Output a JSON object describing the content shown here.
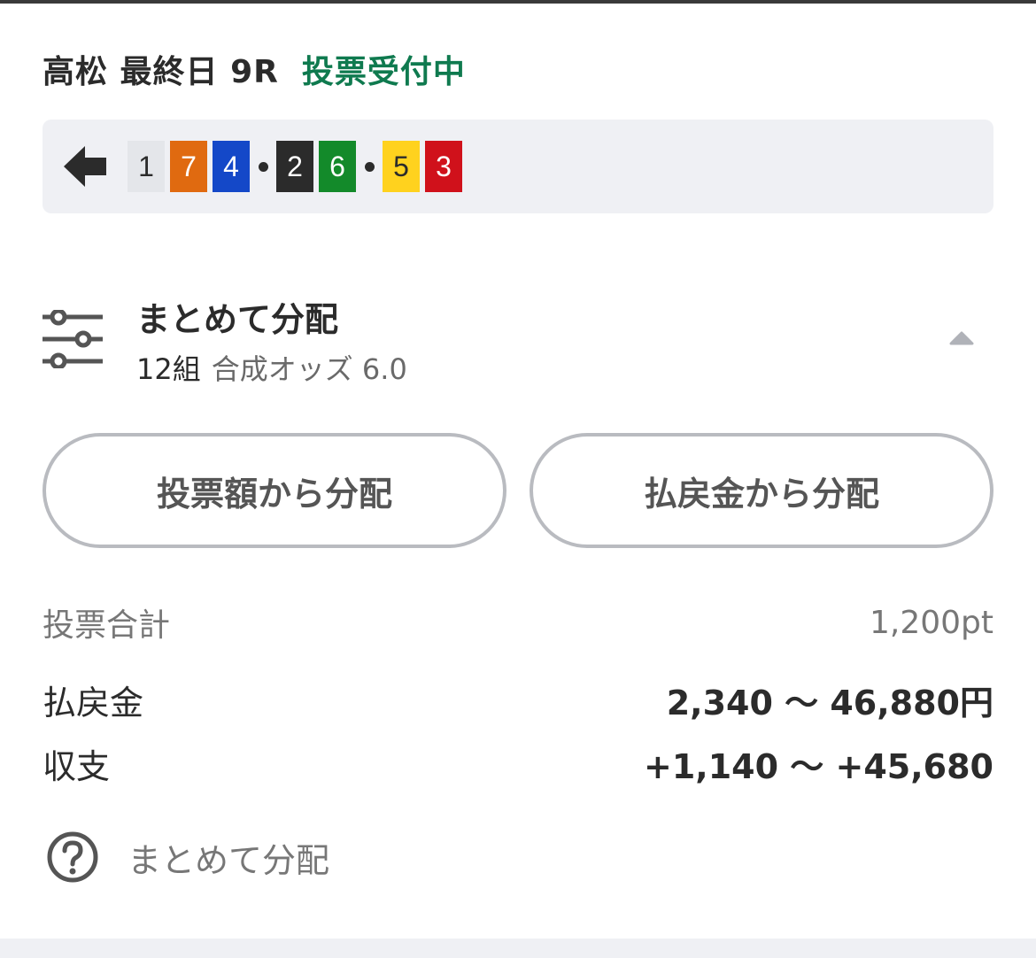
{
  "header": {
    "race_title": "高松 最終日 9R",
    "status": "投票受付中",
    "status_color": "#0f7a4f"
  },
  "combination": {
    "back_icon": "arrow-left-icon",
    "groups": [
      [
        {
          "number": "1",
          "bg": "#e4e6ea",
          "fg": "#2b2b2b"
        },
        {
          "number": "7",
          "bg": "#e06a10",
          "fg": "#ffffff"
        },
        {
          "number": "4",
          "bg": "#1448c8",
          "fg": "#ffffff"
        }
      ],
      [
        {
          "number": "2",
          "bg": "#2b2b2b",
          "fg": "#ffffff"
        },
        {
          "number": "6",
          "bg": "#138a2a",
          "fg": "#ffffff"
        }
      ],
      [
        {
          "number": "5",
          "bg": "#ffd21e",
          "fg": "#2b2b2b"
        },
        {
          "number": "3",
          "bg": "#d0111b",
          "fg": "#ffffff"
        }
      ]
    ]
  },
  "distribution": {
    "icon": "sliders-icon",
    "title": "まとめて分配",
    "count": "12組",
    "odds_text": "合成オッズ 6.0",
    "toggle_icon": "caret-up-icon"
  },
  "buttons": {
    "by_stake": "投票額から分配",
    "by_payout": "払戻金から分配"
  },
  "summary": {
    "total_label": "投票合計",
    "total_value": "1,200pt",
    "payout_label": "払戻金",
    "payout_value": "2,340 〜 46,880円",
    "profit_label": "収支",
    "profit_value": "+1,140 〜 +45,680"
  },
  "help": {
    "icon": "question-circle-icon",
    "label": "まとめて分配"
  }
}
